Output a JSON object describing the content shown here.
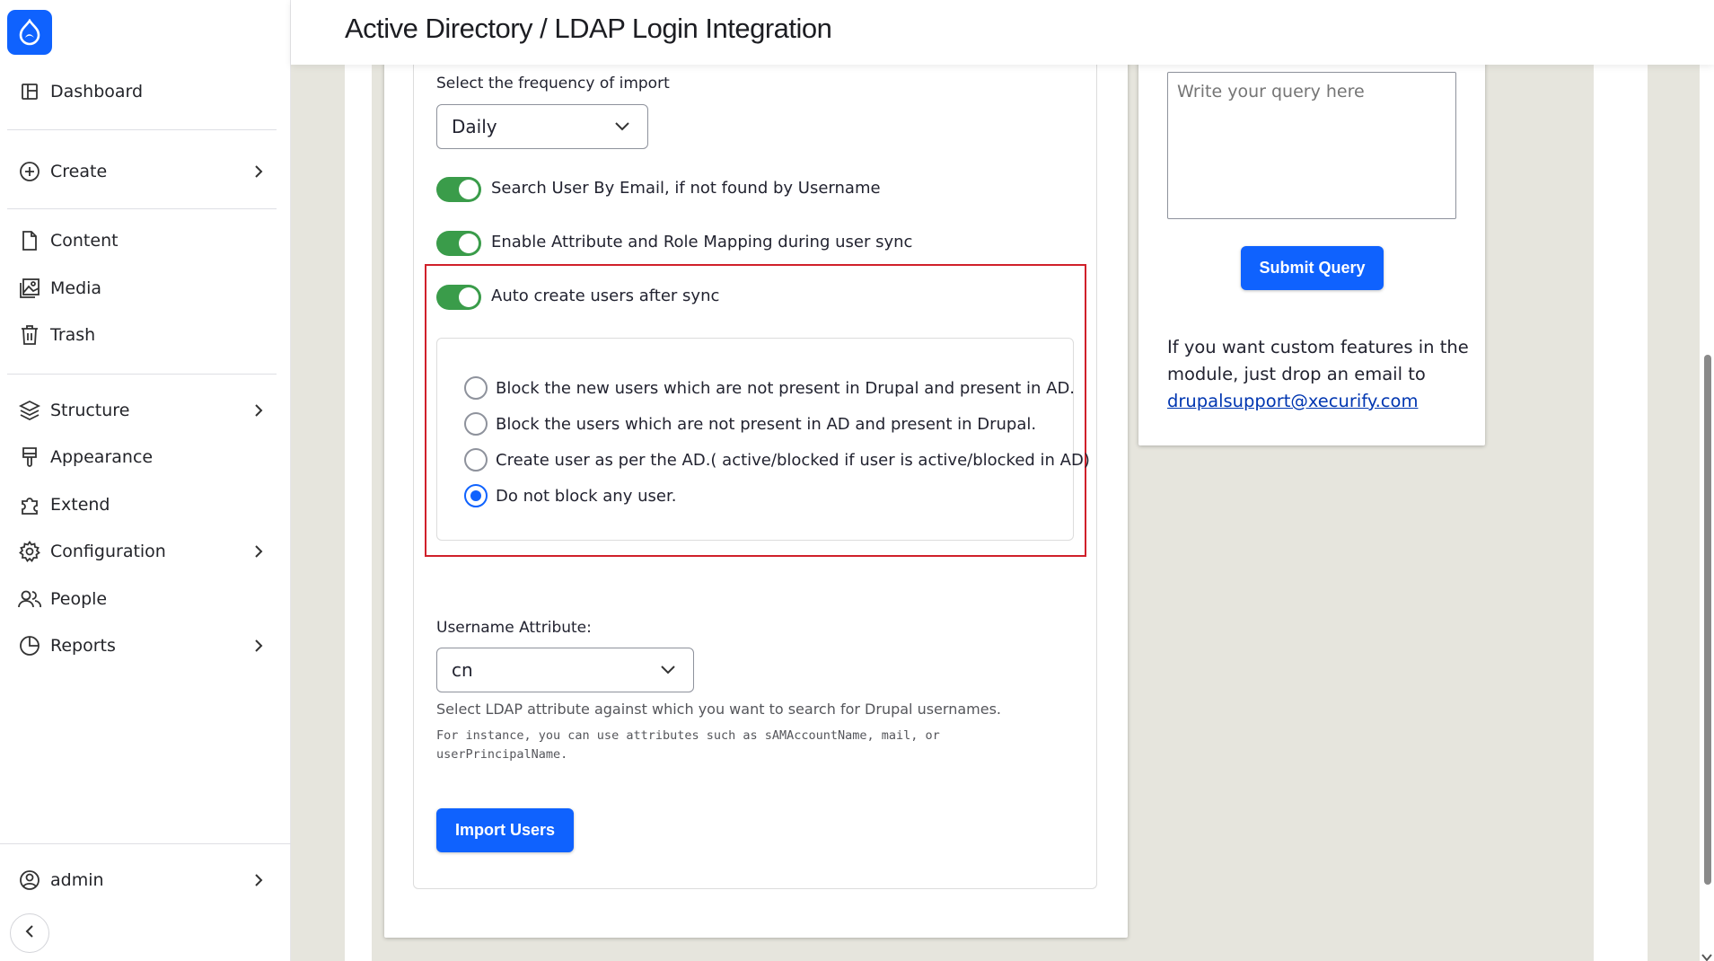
{
  "header": {
    "title": "Active Directory / LDAP Login Integration"
  },
  "sidebar": {
    "items": [
      {
        "label": "Dashboard",
        "icon": "dashboard-icon"
      },
      {
        "label": "Create",
        "icon": "plus-circle-icon"
      },
      {
        "label": "Content",
        "icon": "file-icon"
      },
      {
        "label": "Media",
        "icon": "image-icon"
      },
      {
        "label": "Trash",
        "icon": "trash-icon"
      },
      {
        "label": "Structure",
        "icon": "layers-icon"
      },
      {
        "label": "Appearance",
        "icon": "brush-icon"
      },
      {
        "label": "Extend",
        "icon": "puzzle-icon"
      },
      {
        "label": "Configuration",
        "icon": "gear-icon"
      },
      {
        "label": "People",
        "icon": "people-icon"
      },
      {
        "label": "Reports",
        "icon": "pie-chart-icon"
      }
    ],
    "user": {
      "label": "admin",
      "icon": "user-circle-icon"
    }
  },
  "form": {
    "frequency_label": "Select the frequency of import",
    "frequency_value": "Daily",
    "toggles": [
      {
        "label": "Search User By Email, if not found by Username",
        "on": true
      },
      {
        "label": "Enable Attribute and Role Mapping during user sync",
        "on": true
      },
      {
        "label": "Auto create users after sync",
        "on": true
      }
    ],
    "radio_options": [
      {
        "label": "Block the new users which are not present in Drupal and present in AD.",
        "checked": false
      },
      {
        "label": "Block the users which are not present in AD and present in Drupal.",
        "checked": false
      },
      {
        "label": "Create user as per the AD.( active/blocked if user is active/blocked in AD)",
        "checked": false
      },
      {
        "label": "Do not block any user.",
        "checked": true
      }
    ],
    "username_attr_label": "Username Attribute:",
    "username_attr_value": "cn",
    "username_help": "Select LDAP attribute against which you want to search for Drupal usernames.",
    "username_help_mono": "For instance, you can use attributes such as sAMAccountName, mail, or userPrincipalName.",
    "import_button": "Import Users"
  },
  "support": {
    "query_placeholder": "Write your query here",
    "submit_button": "Submit Query",
    "custom_text": "If you want custom features in the module, just drop an email to",
    "email": "drupalsupport@xecurify.com"
  },
  "colors": {
    "accent": "#0f62fe",
    "toggle_on": "#3a9c4a",
    "highlight_border": "#d0202a"
  }
}
